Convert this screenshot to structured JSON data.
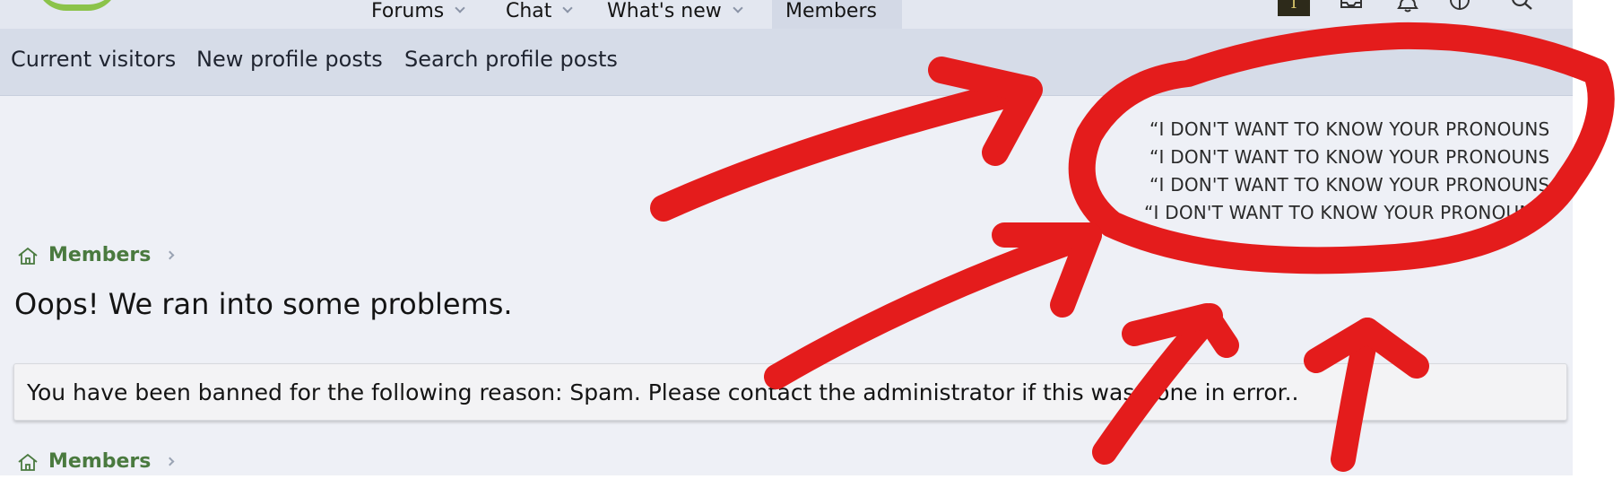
{
  "top_nav": {
    "items": [
      {
        "label": "Forums",
        "has_dropdown": true
      },
      {
        "label": "Chat",
        "has_dropdown": true
      },
      {
        "label": "What's new",
        "has_dropdown": true
      },
      {
        "label": "Members",
        "has_dropdown": false,
        "selected": true
      }
    ],
    "user_initial": "T",
    "icons": [
      "inbox-icon",
      "bell-icon",
      "theme-icon",
      "search-icon"
    ]
  },
  "sub_nav": {
    "links": [
      "Current visitors",
      "New profile posts",
      "Search profile posts"
    ]
  },
  "quote": {
    "lines": [
      "“I DON'T WANT TO KNOW YOUR PRONOUNS",
      "“I DON'T WANT TO KNOW YOUR PRONOUNS",
      "“I DON'T WANT TO KNOW YOUR PRONOUNS",
      "“I DON'T WANT TO KNOW YOUR PRONOUNS"
    ]
  },
  "breadcrumb": {
    "label": "Members"
  },
  "page_title": "Oops! We ran into some problems.",
  "notice": "You have been banned for the following reason: Spam. Please contact the administrator if this was done in error..",
  "annotation": {
    "color": "#e41c1c"
  }
}
